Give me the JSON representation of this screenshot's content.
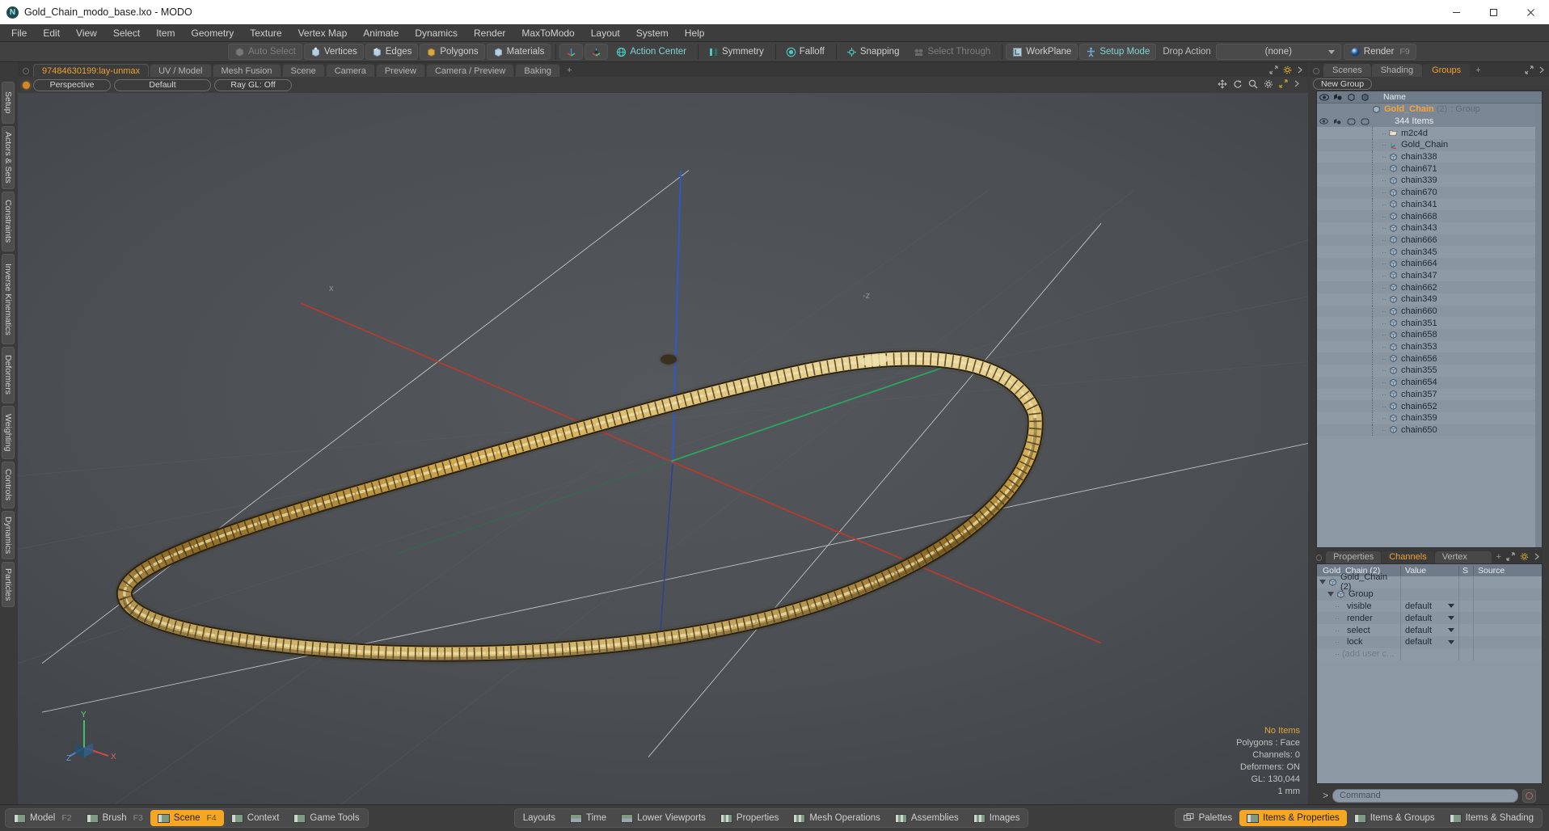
{
  "window": {
    "title": "Gold_Chain_modo_base.lxo - MODO",
    "app_icon": "modo-logo-icon",
    "minimize": "–",
    "maximize": "□",
    "close": "✕"
  },
  "menubar": {
    "items": [
      "File",
      "Edit",
      "View",
      "Select",
      "Item",
      "Geometry",
      "Texture",
      "Vertex Map",
      "Animate",
      "Dynamics",
      "Render",
      "MaxToModo",
      "Layout",
      "System",
      "Help"
    ]
  },
  "toolbar": {
    "auto_select": "Auto Select",
    "vertices": "Vertices",
    "edges": "Edges",
    "polygons": "Polygons",
    "materials": "Materials",
    "action_center": "Action Center",
    "symmetry": "Symmetry",
    "falloff": "Falloff",
    "snapping": "Snapping",
    "select_through": "Select Through",
    "workplane": "WorkPlane",
    "setup_mode": "Setup Mode",
    "drop_action_label": "Drop Action",
    "drop_action_value": "(none)",
    "render": "Render",
    "render_fkey": "F9"
  },
  "left_rail": {
    "tabs": [
      "Setup",
      "Actors & Sets",
      "Constraints",
      "Inverse Kinematics",
      "Deformers",
      "Weighting",
      "Controls",
      "Dynamics",
      "Particles"
    ]
  },
  "viewport": {
    "tabs": [
      {
        "label": "97484630199:lay-unmax",
        "active": true
      },
      {
        "label": "UV / Model",
        "active": false
      },
      {
        "label": "Mesh Fusion",
        "active": false
      },
      {
        "label": "Scene",
        "active": false
      },
      {
        "label": "Camera",
        "active": false
      },
      {
        "label": "Preview",
        "active": false
      },
      {
        "label": "Camera / Preview",
        "active": false
      },
      {
        "label": "Baking",
        "active": false
      }
    ],
    "add_tab": "+",
    "view_mode": "Perspective",
    "shading": "Default",
    "raygl": "Ray GL: Off",
    "info": {
      "items": "No Items",
      "polygons": "Polygons : Face",
      "channels": "Channels: 0",
      "deformers": "Deformers: ON",
      "gl": "GL: 130,044",
      "units": "1 mm"
    },
    "axis_x": "x",
    "axis_z": "-z",
    "gizmo_x": "X",
    "gizmo_y": "Y",
    "gizmo_z": "Z"
  },
  "right_panel": {
    "tabs": [
      {
        "label": "Scenes",
        "active": false
      },
      {
        "label": "Shading",
        "active": false
      },
      {
        "label": "Groups",
        "active": true
      }
    ],
    "add_tab": "+",
    "new_group_button": "New Group",
    "list_header": {
      "name": "Name"
    },
    "group": {
      "name": "Gold_Chain",
      "count": "(2)",
      "type": ": Group",
      "subtitle": "344 Items"
    },
    "items": [
      {
        "label": "m2c4d",
        "icon": "folder-icon"
      },
      {
        "label": "Gold_Chain",
        "icon": "locator-icon"
      },
      {
        "label": "chain338",
        "icon": "mesh-icon"
      },
      {
        "label": "chain671",
        "icon": "mesh-icon"
      },
      {
        "label": "chain339",
        "icon": "mesh-icon"
      },
      {
        "label": "chain670",
        "icon": "mesh-icon"
      },
      {
        "label": "chain341",
        "icon": "mesh-icon"
      },
      {
        "label": "chain668",
        "icon": "mesh-icon"
      },
      {
        "label": "chain343",
        "icon": "mesh-icon"
      },
      {
        "label": "chain666",
        "icon": "mesh-icon"
      },
      {
        "label": "chain345",
        "icon": "mesh-icon"
      },
      {
        "label": "chain664",
        "icon": "mesh-icon"
      },
      {
        "label": "chain347",
        "icon": "mesh-icon"
      },
      {
        "label": "chain662",
        "icon": "mesh-icon"
      },
      {
        "label": "chain349",
        "icon": "mesh-icon"
      },
      {
        "label": "chain660",
        "icon": "mesh-icon"
      },
      {
        "label": "chain351",
        "icon": "mesh-icon"
      },
      {
        "label": "chain658",
        "icon": "mesh-icon"
      },
      {
        "label": "chain353",
        "icon": "mesh-icon"
      },
      {
        "label": "chain656",
        "icon": "mesh-icon"
      },
      {
        "label": "chain355",
        "icon": "mesh-icon"
      },
      {
        "label": "chain654",
        "icon": "mesh-icon"
      },
      {
        "label": "chain357",
        "icon": "mesh-icon"
      },
      {
        "label": "chain652",
        "icon": "mesh-icon"
      },
      {
        "label": "chain359",
        "icon": "mesh-icon"
      },
      {
        "label": "chain650",
        "icon": "mesh-icon"
      }
    ]
  },
  "channels_panel": {
    "tabs": [
      {
        "label": "Properties",
        "active": false
      },
      {
        "label": "Channels",
        "active": true
      },
      {
        "label": "Vertex Maps",
        "active": false
      }
    ],
    "add_tab": "+",
    "headers": {
      "name": "Gold_Chain (2)",
      "value": "Value",
      "s": "S",
      "source": "Source"
    },
    "rows": [
      {
        "name": "Gold_Chain (2)",
        "value": "",
        "type": "root"
      },
      {
        "name": "Group",
        "value": "",
        "type": "group"
      },
      {
        "name": "visible",
        "value": "default",
        "type": "channel"
      },
      {
        "name": "render",
        "value": "default",
        "type": "channel"
      },
      {
        "name": "select",
        "value": "default",
        "type": "channel"
      },
      {
        "name": "lock",
        "value": "default",
        "type": "channel"
      },
      {
        "name": "(add user c...",
        "value": "",
        "type": "adduser"
      }
    ]
  },
  "command_bar": {
    "prompt": ">",
    "placeholder": "Command"
  },
  "bottom_bar": {
    "left_group": [
      {
        "label": "Model",
        "fkey": "F2",
        "active": false,
        "icon": "viewport-swatch"
      },
      {
        "label": "Brush",
        "fkey": "F3",
        "active": false,
        "icon": "viewport-swatch"
      },
      {
        "label": "Scene",
        "fkey": "F4",
        "active": true,
        "icon": "viewport-swatch"
      },
      {
        "label": "Context",
        "fkey": "",
        "active": false,
        "icon": "viewport-swatch"
      },
      {
        "label": "Game Tools",
        "fkey": "",
        "active": false,
        "icon": "viewport-swatch"
      }
    ],
    "center_group": [
      {
        "label": "Layouts",
        "icon": "none"
      },
      {
        "label": "Time",
        "icon": "split-swatch"
      },
      {
        "label": "Lower Viewports",
        "icon": "split-swatch"
      },
      {
        "label": "Properties",
        "icon": "triple-swatch"
      },
      {
        "label": "Mesh Operations",
        "icon": "triple-swatch"
      },
      {
        "label": "Assemblies",
        "icon": "triple-swatch"
      },
      {
        "label": "Images",
        "icon": "triple-swatch"
      }
    ],
    "right_group": [
      {
        "label": "Palettes",
        "active": false,
        "icon": "palettes-icon"
      },
      {
        "label": "Items & Properties",
        "active": true,
        "icon": "viewport-swatch"
      },
      {
        "label": "Items & Groups",
        "active": false,
        "icon": "viewport-swatch"
      },
      {
        "label": "Items & Shading",
        "active": false,
        "icon": "viewport-swatch"
      }
    ]
  },
  "colors": {
    "accent_orange": "#f0a030",
    "accent_active": "#f5a623",
    "panel_bg": "#3a3a3a",
    "list_bg": "#8d98a5",
    "gold": "#d6b25e"
  }
}
